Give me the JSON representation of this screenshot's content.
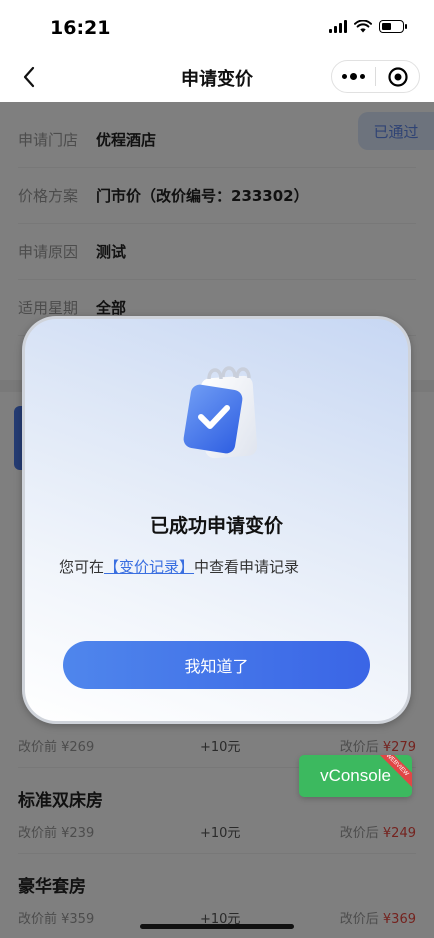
{
  "status_bar": {
    "time": "16:21"
  },
  "nav": {
    "title": "申请变价"
  },
  "status_tag": "已通过",
  "info_rows": [
    {
      "label": "申请门店",
      "value": "优程酒店"
    },
    {
      "label": "价格方案",
      "value": "门市价（改价编号：233302）"
    },
    {
      "label": "申请原因",
      "value": "测试"
    },
    {
      "label": "适用星期",
      "value": "全部"
    }
  ],
  "rooms": [
    {
      "name": "",
      "before": "改价前 ¥269",
      "diff": "+10元",
      "after_label": "改价后",
      "after_price": "¥279"
    },
    {
      "name": "标准双床房",
      "before": "改价前 ¥239",
      "diff": "+10元",
      "after_label": "改价后",
      "after_price": "¥249"
    },
    {
      "name": "豪华套房",
      "before": "改价前 ¥359",
      "diff": "+10元",
      "after_label": "改价后",
      "after_price": "¥369"
    }
  ],
  "modal": {
    "title": "已成功申请变价",
    "desc_prefix": "您可在",
    "desc_link": "【变价记录】",
    "desc_suffix": "中查看申请记录",
    "button_label": "我知道了"
  },
  "vconsole": {
    "label": "vConsole",
    "tag": "WEBVIEW"
  },
  "colors": {
    "accent": "#3a65e6",
    "price_red": "#e8473f",
    "vconsole_green": "#3cb95f"
  }
}
